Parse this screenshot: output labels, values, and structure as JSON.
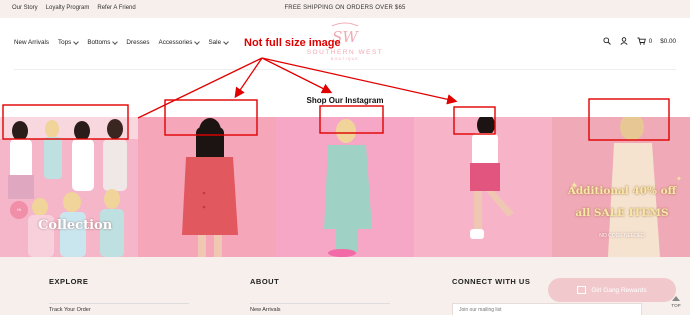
{
  "topbar": {
    "links": [
      "Our Story",
      "Loyalty Program",
      "Refer A Friend"
    ],
    "announcement": "FREE SHIPPING ON ORDERS OVER $65"
  },
  "nav": {
    "items": [
      {
        "label": "New Arrivals",
        "chevron": false
      },
      {
        "label": "Tops",
        "chevron": true
      },
      {
        "label": "Bottoms",
        "chevron": true
      },
      {
        "label": "Dresses",
        "chevron": false
      },
      {
        "label": "Accessories",
        "chevron": true
      },
      {
        "label": "Sale",
        "chevron": true
      }
    ]
  },
  "logo": {
    "monogram": "SW",
    "name": "SOUTHERN WEST",
    "sub": "BOUTIQUE"
  },
  "header_icons": {
    "cart_count": "0",
    "cart_total": "$0.00"
  },
  "section": {
    "title": "Shop Our Instagram"
  },
  "instagram": {
    "tile1_text": "Collection",
    "tile1_badge": "Hi",
    "tile5_line1": "Additional 40% off",
    "tile5_line2": "all SALE ITEMS",
    "tile5_line3": "NO CODE NEEDED"
  },
  "annotation": {
    "label": "Not full size image",
    "color": "#e00000"
  },
  "footer": {
    "col1": {
      "title": "EXPLORE",
      "link": "Track Your Order"
    },
    "col2": {
      "title": "ABOUT",
      "link": "New Arrivals"
    },
    "col3": {
      "title": "CONNECT WITH US"
    },
    "email_placeholder": "Join our mailing list",
    "rewards_label": "Girl Gang Rewards",
    "top_label": "TOP"
  },
  "colors": {
    "topbar_bg": "#f7efec",
    "brand_pink": "#f1a9b4",
    "annotation_red": "#e00000"
  }
}
